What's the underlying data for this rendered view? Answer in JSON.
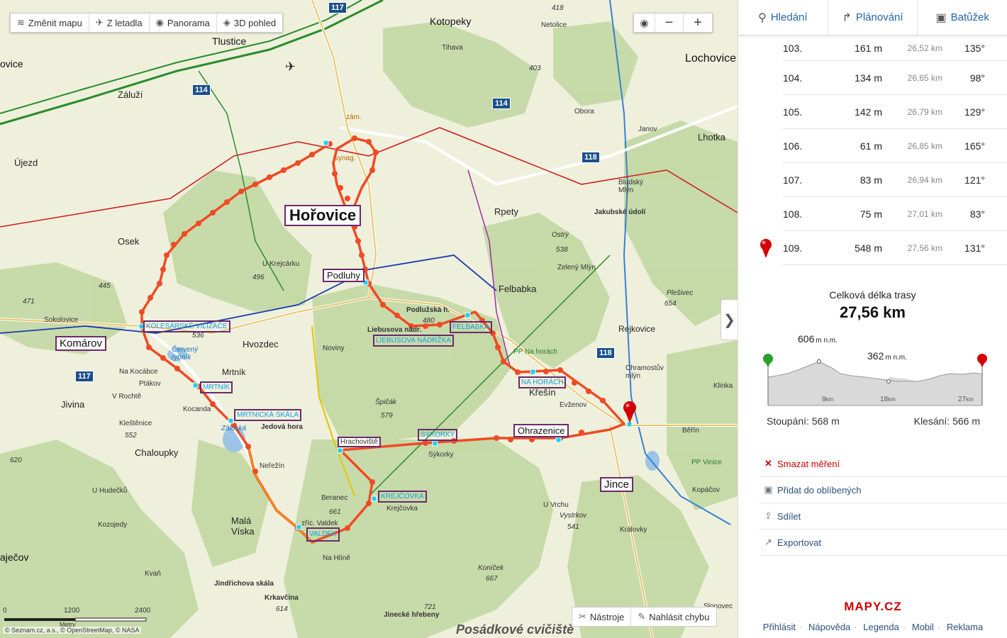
{
  "toolbar": {
    "change_map": "Změnit mapu",
    "aerial": "Z letadla",
    "panorama": "Panorama",
    "view3d": "3D pohled"
  },
  "map_tools": {
    "tools": "Nástroje",
    "report": "Nahlásit chybu"
  },
  "copyright": "© Seznam.cz, a.s., © OpenStreetMap, © NASA",
  "scale": {
    "labels": [
      "0",
      "1200",
      "2400"
    ],
    "unit": "Metry"
  },
  "road_numbers": [
    "117",
    "114",
    "114",
    "118",
    "118",
    "117"
  ],
  "route_color": "#f04a24",
  "places": {
    "horovice": "Hořovice",
    "podluhy": "Podluhy",
    "komarov": "Komárov",
    "ohrazenice": "Ohrazenice",
    "jince": "Jince",
    "kotopeky": "Kotopeky",
    "tlustice": "Tlustice",
    "lochovice": "Lochovice",
    "lhotka": "Lhotka",
    "osek": "Osek",
    "felbabka": "Felbabka",
    "rpety": "Rpety",
    "hvozdec": "Hvozdec",
    "mrtnik": "Mrtník",
    "kresin": "Křešín",
    "jivina": "Jivina",
    "chaloupky": "Chaloupky",
    "mala_viska": "Malá\nVíska",
    "ujezd": "Újezd",
    "zaluzi": "Záluží",
    "rejkovice": "Rejkovice",
    "netolice": "Netolice",
    "tihava": "Tihava",
    "obora": "Obora",
    "berin": "Běřín",
    "sykorky": "Sýkorky",
    "berenec": "Beranec",
    "nerezin": "Neřežín",
    "jedova_hora": "Jedová hora",
    "jakubske": "Jakubské údolí",
    "podluzsky": "Podlužská h.",
    "liebusova": "Liebusova nádr.",
    "jindrichova": "Jindřichova skála",
    "krkavcina": "Krkavčina",
    "jinecke": "Jinecké hřebeny",
    "posadkove": "Posádkové cvičiště",
    "ostry": "Ostrý",
    "plesivec": "Plešivec",
    "spicak": "Špičák",
    "konicek": "Koníček",
    "vystrkov": "Vystrkov",
    "hracovistec": "Hrachoviště",
    "krejcovka": "Krejčovka",
    "pp_na_horach": "PP Na horách",
    "pp_vinice": "PP Vinice",
    "kvan": "Kvaň",
    "krasa": "Kleštěnice",
    "slonovec": "Slonovec",
    "klinka": "Klinka",
    "ajecov": "aječov",
    "vice": "ovice",
    "zricnina": "zříc. Valdek",
    "kralovky": "Královky",
    "kopacov": "Kopáčov",
    "synag": "synag.",
    "zam": "zám.",
    "sokolovice": "Sokolovice",
    "na_kocabce": "Na Kocábce",
    "ptakov": "Ptákov",
    "kocanda": "Kocanda",
    "noviny": "Noviny",
    "na_hline": "Na Hlíně",
    "u_krejcarku": "U Krejcárku",
    "zeleny_mlyn": "Zelený Mlýn",
    "chramostuv": "Chramostův\nmlýn",
    "evzenov": "Evženov",
    "janov": "Janov",
    "bludsky": "Bludský\nMlýn",
    "u_vrchu": "U Vrchu",
    "u_hudecku": "U Hudečků",
    "kozojedy": "Kozojedy",
    "u_rochte": "V Rochtě",
    "cerveny": "Červený\nrybník",
    "zaduska": "Záluská"
  },
  "elevations": [
    "418",
    "403",
    "445",
    "471",
    "496",
    "536",
    "538",
    "654",
    "552",
    "620",
    "579",
    "661",
    "614",
    "721",
    "667",
    "541",
    "480",
    "606",
    "362"
  ],
  "poi_labels": [
    "KOLESÁRSKÉ VILIZAČE",
    "MRTNÍK",
    "MRTNICKÁ SKÁLA",
    "LIEBUSOVA NÁDRŽKA",
    "FELBABKA",
    "NA HORÁCH",
    "SÝKORKY",
    "KREJČOVKA",
    "VALDEK"
  ],
  "panel": {
    "tabs": {
      "search": "Hledání",
      "planning": "Plánování",
      "backpack": "Batůžek"
    },
    "segments": [
      {
        "num": "103.",
        "dist": "161 m",
        "cum": "26,52 km",
        "angle": "135°"
      },
      {
        "num": "104.",
        "dist": "134 m",
        "cum": "26,65 km",
        "angle": "98°"
      },
      {
        "num": "105.",
        "dist": "142 m",
        "cum": "26,79 km",
        "angle": "129°"
      },
      {
        "num": "106.",
        "dist": "61 m",
        "cum": "26,85 km",
        "angle": "165°"
      },
      {
        "num": "107.",
        "dist": "83 m",
        "cum": "26,94 km",
        "angle": "121°"
      },
      {
        "num": "108.",
        "dist": "75 m",
        "cum": "27,01 km",
        "angle": "83°"
      },
      {
        "num": "109.",
        "dist": "548 m",
        "cum": "27,56 km",
        "angle": "131°"
      }
    ],
    "total_label": "Celková délka trasy",
    "total_value": "27,56 km",
    "profile": {
      "max_label": "606",
      "min_label": "362",
      "unit_suffix": "m n.m.",
      "ticks": [
        "9",
        "18",
        "27"
      ],
      "tick_unit": "km",
      "ascent": "Stoupání: 568 m",
      "descent": "Klesání: 566 m"
    },
    "actions": {
      "delete": "Smazat měření",
      "favorite": "Přidat do oblíbených",
      "share": "Sdílet",
      "export": "Exportovat"
    },
    "brand": "MAPY.CZ",
    "footer": [
      "Přihlásit",
      "Nápověda",
      "Legenda",
      "Mobil",
      "Reklama"
    ]
  },
  "colors": {
    "route": "#f04a24",
    "forest": "#c9dcae",
    "highway": "#2a8c2a",
    "label_box": "#6b2a6b",
    "link": "#2a4f7a",
    "danger": "#cc0000"
  }
}
